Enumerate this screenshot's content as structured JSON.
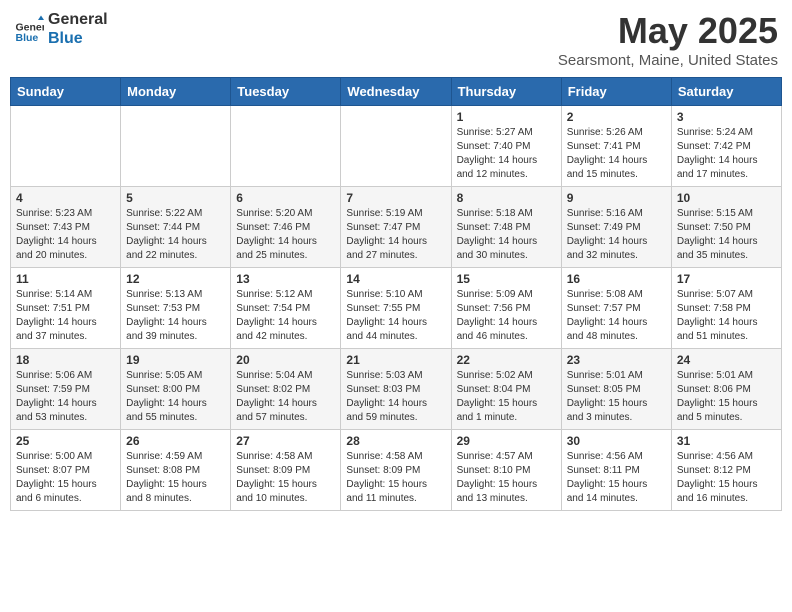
{
  "header": {
    "logo_general": "General",
    "logo_blue": "Blue",
    "month_title": "May 2025",
    "location": "Searsmont, Maine, United States"
  },
  "weekdays": [
    "Sunday",
    "Monday",
    "Tuesday",
    "Wednesday",
    "Thursday",
    "Friday",
    "Saturday"
  ],
  "weeks": [
    [
      {
        "day": "",
        "info": ""
      },
      {
        "day": "",
        "info": ""
      },
      {
        "day": "",
        "info": ""
      },
      {
        "day": "",
        "info": ""
      },
      {
        "day": "1",
        "info": "Sunrise: 5:27 AM\nSunset: 7:40 PM\nDaylight: 14 hours\nand 12 minutes."
      },
      {
        "day": "2",
        "info": "Sunrise: 5:26 AM\nSunset: 7:41 PM\nDaylight: 14 hours\nand 15 minutes."
      },
      {
        "day": "3",
        "info": "Sunrise: 5:24 AM\nSunset: 7:42 PM\nDaylight: 14 hours\nand 17 minutes."
      }
    ],
    [
      {
        "day": "4",
        "info": "Sunrise: 5:23 AM\nSunset: 7:43 PM\nDaylight: 14 hours\nand 20 minutes."
      },
      {
        "day": "5",
        "info": "Sunrise: 5:22 AM\nSunset: 7:44 PM\nDaylight: 14 hours\nand 22 minutes."
      },
      {
        "day": "6",
        "info": "Sunrise: 5:20 AM\nSunset: 7:46 PM\nDaylight: 14 hours\nand 25 minutes."
      },
      {
        "day": "7",
        "info": "Sunrise: 5:19 AM\nSunset: 7:47 PM\nDaylight: 14 hours\nand 27 minutes."
      },
      {
        "day": "8",
        "info": "Sunrise: 5:18 AM\nSunset: 7:48 PM\nDaylight: 14 hours\nand 30 minutes."
      },
      {
        "day": "9",
        "info": "Sunrise: 5:16 AM\nSunset: 7:49 PM\nDaylight: 14 hours\nand 32 minutes."
      },
      {
        "day": "10",
        "info": "Sunrise: 5:15 AM\nSunset: 7:50 PM\nDaylight: 14 hours\nand 35 minutes."
      }
    ],
    [
      {
        "day": "11",
        "info": "Sunrise: 5:14 AM\nSunset: 7:51 PM\nDaylight: 14 hours\nand 37 minutes."
      },
      {
        "day": "12",
        "info": "Sunrise: 5:13 AM\nSunset: 7:53 PM\nDaylight: 14 hours\nand 39 minutes."
      },
      {
        "day": "13",
        "info": "Sunrise: 5:12 AM\nSunset: 7:54 PM\nDaylight: 14 hours\nand 42 minutes."
      },
      {
        "day": "14",
        "info": "Sunrise: 5:10 AM\nSunset: 7:55 PM\nDaylight: 14 hours\nand 44 minutes."
      },
      {
        "day": "15",
        "info": "Sunrise: 5:09 AM\nSunset: 7:56 PM\nDaylight: 14 hours\nand 46 minutes."
      },
      {
        "day": "16",
        "info": "Sunrise: 5:08 AM\nSunset: 7:57 PM\nDaylight: 14 hours\nand 48 minutes."
      },
      {
        "day": "17",
        "info": "Sunrise: 5:07 AM\nSunset: 7:58 PM\nDaylight: 14 hours\nand 51 minutes."
      }
    ],
    [
      {
        "day": "18",
        "info": "Sunrise: 5:06 AM\nSunset: 7:59 PM\nDaylight: 14 hours\nand 53 minutes."
      },
      {
        "day": "19",
        "info": "Sunrise: 5:05 AM\nSunset: 8:00 PM\nDaylight: 14 hours\nand 55 minutes."
      },
      {
        "day": "20",
        "info": "Sunrise: 5:04 AM\nSunset: 8:02 PM\nDaylight: 14 hours\nand 57 minutes."
      },
      {
        "day": "21",
        "info": "Sunrise: 5:03 AM\nSunset: 8:03 PM\nDaylight: 14 hours\nand 59 minutes."
      },
      {
        "day": "22",
        "info": "Sunrise: 5:02 AM\nSunset: 8:04 PM\nDaylight: 15 hours\nand 1 minute."
      },
      {
        "day": "23",
        "info": "Sunrise: 5:01 AM\nSunset: 8:05 PM\nDaylight: 15 hours\nand 3 minutes."
      },
      {
        "day": "24",
        "info": "Sunrise: 5:01 AM\nSunset: 8:06 PM\nDaylight: 15 hours\nand 5 minutes."
      }
    ],
    [
      {
        "day": "25",
        "info": "Sunrise: 5:00 AM\nSunset: 8:07 PM\nDaylight: 15 hours\nand 6 minutes."
      },
      {
        "day": "26",
        "info": "Sunrise: 4:59 AM\nSunset: 8:08 PM\nDaylight: 15 hours\nand 8 minutes."
      },
      {
        "day": "27",
        "info": "Sunrise: 4:58 AM\nSunset: 8:09 PM\nDaylight: 15 hours\nand 10 minutes."
      },
      {
        "day": "28",
        "info": "Sunrise: 4:58 AM\nSunset: 8:09 PM\nDaylight: 15 hours\nand 11 minutes."
      },
      {
        "day": "29",
        "info": "Sunrise: 4:57 AM\nSunset: 8:10 PM\nDaylight: 15 hours\nand 13 minutes."
      },
      {
        "day": "30",
        "info": "Sunrise: 4:56 AM\nSunset: 8:11 PM\nDaylight: 15 hours\nand 14 minutes."
      },
      {
        "day": "31",
        "info": "Sunrise: 4:56 AM\nSunset: 8:12 PM\nDaylight: 15 hours\nand 16 minutes."
      }
    ]
  ]
}
